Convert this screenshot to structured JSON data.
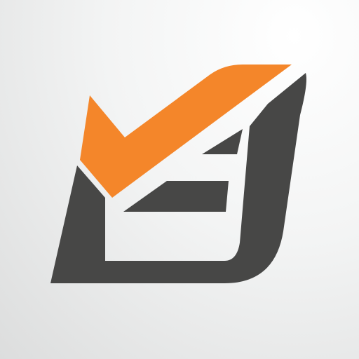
{
  "app_icon": {
    "icon_name": "checkbox-check-icon",
    "colors": {
      "background_light": "#ffffff",
      "background_dark": "#dcdddd",
      "box": "#474746",
      "check": "#f4862a"
    }
  }
}
